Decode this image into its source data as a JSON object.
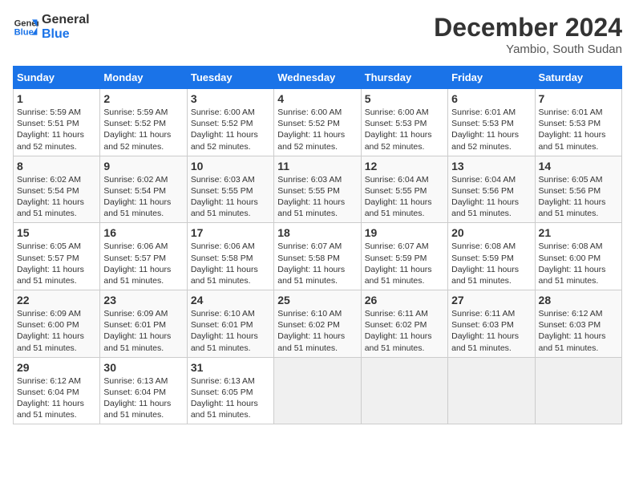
{
  "header": {
    "logo_line1": "General",
    "logo_line2": "Blue",
    "month": "December 2024",
    "location": "Yambio, South Sudan"
  },
  "days_of_week": [
    "Sunday",
    "Monday",
    "Tuesday",
    "Wednesday",
    "Thursday",
    "Friday",
    "Saturday"
  ],
  "weeks": [
    [
      {
        "day": 1,
        "sunrise": "5:59 AM",
        "sunset": "5:51 PM",
        "daylight": "11 hours and 52 minutes."
      },
      {
        "day": 2,
        "sunrise": "5:59 AM",
        "sunset": "5:52 PM",
        "daylight": "11 hours and 52 minutes."
      },
      {
        "day": 3,
        "sunrise": "6:00 AM",
        "sunset": "5:52 PM",
        "daylight": "11 hours and 52 minutes."
      },
      {
        "day": 4,
        "sunrise": "6:00 AM",
        "sunset": "5:52 PM",
        "daylight": "11 hours and 52 minutes."
      },
      {
        "day": 5,
        "sunrise": "6:00 AM",
        "sunset": "5:53 PM",
        "daylight": "11 hours and 52 minutes."
      },
      {
        "day": 6,
        "sunrise": "6:01 AM",
        "sunset": "5:53 PM",
        "daylight": "11 hours and 52 minutes."
      },
      {
        "day": 7,
        "sunrise": "6:01 AM",
        "sunset": "5:53 PM",
        "daylight": "11 hours and 51 minutes."
      }
    ],
    [
      {
        "day": 8,
        "sunrise": "6:02 AM",
        "sunset": "5:54 PM",
        "daylight": "11 hours and 51 minutes."
      },
      {
        "day": 9,
        "sunrise": "6:02 AM",
        "sunset": "5:54 PM",
        "daylight": "11 hours and 51 minutes."
      },
      {
        "day": 10,
        "sunrise": "6:03 AM",
        "sunset": "5:55 PM",
        "daylight": "11 hours and 51 minutes."
      },
      {
        "day": 11,
        "sunrise": "6:03 AM",
        "sunset": "5:55 PM",
        "daylight": "11 hours and 51 minutes."
      },
      {
        "day": 12,
        "sunrise": "6:04 AM",
        "sunset": "5:55 PM",
        "daylight": "11 hours and 51 minutes."
      },
      {
        "day": 13,
        "sunrise": "6:04 AM",
        "sunset": "5:56 PM",
        "daylight": "11 hours and 51 minutes."
      },
      {
        "day": 14,
        "sunrise": "6:05 AM",
        "sunset": "5:56 PM",
        "daylight": "11 hours and 51 minutes."
      }
    ],
    [
      {
        "day": 15,
        "sunrise": "6:05 AM",
        "sunset": "5:57 PM",
        "daylight": "11 hours and 51 minutes."
      },
      {
        "day": 16,
        "sunrise": "6:06 AM",
        "sunset": "5:57 PM",
        "daylight": "11 hours and 51 minutes."
      },
      {
        "day": 17,
        "sunrise": "6:06 AM",
        "sunset": "5:58 PM",
        "daylight": "11 hours and 51 minutes."
      },
      {
        "day": 18,
        "sunrise": "6:07 AM",
        "sunset": "5:58 PM",
        "daylight": "11 hours and 51 minutes."
      },
      {
        "day": 19,
        "sunrise": "6:07 AM",
        "sunset": "5:59 PM",
        "daylight": "11 hours and 51 minutes."
      },
      {
        "day": 20,
        "sunrise": "6:08 AM",
        "sunset": "5:59 PM",
        "daylight": "11 hours and 51 minutes."
      },
      {
        "day": 21,
        "sunrise": "6:08 AM",
        "sunset": "6:00 PM",
        "daylight": "11 hours and 51 minutes."
      }
    ],
    [
      {
        "day": 22,
        "sunrise": "6:09 AM",
        "sunset": "6:00 PM",
        "daylight": "11 hours and 51 minutes."
      },
      {
        "day": 23,
        "sunrise": "6:09 AM",
        "sunset": "6:01 PM",
        "daylight": "11 hours and 51 minutes."
      },
      {
        "day": 24,
        "sunrise": "6:10 AM",
        "sunset": "6:01 PM",
        "daylight": "11 hours and 51 minutes."
      },
      {
        "day": 25,
        "sunrise": "6:10 AM",
        "sunset": "6:02 PM",
        "daylight": "11 hours and 51 minutes."
      },
      {
        "day": 26,
        "sunrise": "6:11 AM",
        "sunset": "6:02 PM",
        "daylight": "11 hours and 51 minutes."
      },
      {
        "day": 27,
        "sunrise": "6:11 AM",
        "sunset": "6:03 PM",
        "daylight": "11 hours and 51 minutes."
      },
      {
        "day": 28,
        "sunrise": "6:12 AM",
        "sunset": "6:03 PM",
        "daylight": "11 hours and 51 minutes."
      }
    ],
    [
      {
        "day": 29,
        "sunrise": "6:12 AM",
        "sunset": "6:04 PM",
        "daylight": "11 hours and 51 minutes."
      },
      {
        "day": 30,
        "sunrise": "6:13 AM",
        "sunset": "6:04 PM",
        "daylight": "11 hours and 51 minutes."
      },
      {
        "day": 31,
        "sunrise": "6:13 AM",
        "sunset": "6:05 PM",
        "daylight": "11 hours and 51 minutes."
      },
      null,
      null,
      null,
      null
    ]
  ],
  "labels": {
    "sunrise": "Sunrise:",
    "sunset": "Sunset:",
    "daylight": "Daylight:"
  }
}
